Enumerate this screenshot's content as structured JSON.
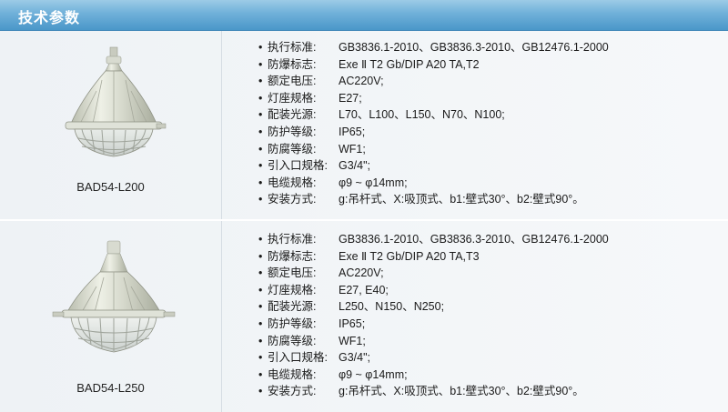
{
  "header": {
    "title": "技术参数"
  },
  "products": [
    {
      "model": "BAD54-L200",
      "specs": [
        {
          "label": "执行标准:",
          "value": "GB3836.1-2010、GB3836.3-2010、GB12476.1-2000"
        },
        {
          "label": "防爆标志:",
          "value": "Exe Ⅱ T2 Gb/DIP A20 TA,T2"
        },
        {
          "label": "额定电压:",
          "value": "AC220V;"
        },
        {
          "label": "灯座规格:",
          "value": "E27;"
        },
        {
          "label": "配装光源:",
          "value": "L70、L100、L150、N70、N100;"
        },
        {
          "label": "防护等级:",
          "value": "IP65;"
        },
        {
          "label": "防腐等级:",
          "value": "WF1;"
        },
        {
          "label": "引入口规格:",
          "value": "G3/4\";"
        },
        {
          "label": "电缆规格:",
          "value": "φ9 ~ φ14mm;"
        },
        {
          "label": "安装方式:",
          "value": "g:吊杆式、X:吸顶式、b1:壁式30°、b2:壁式90°。"
        }
      ]
    },
    {
      "model": "BAD54-L250",
      "specs": [
        {
          "label": "执行标准:",
          "value": "GB3836.1-2010、GB3836.3-2010、GB12476.1-2000"
        },
        {
          "label": "防爆标志:",
          "value": "Exe Ⅱ T2 Gb/DIP A20 TA,T3"
        },
        {
          "label": "额定电压:",
          "value": "AC220V;"
        },
        {
          "label": "灯座规格:",
          "value": "E27, E40;"
        },
        {
          "label": "配装光源:",
          "value": "L250、N150、N250;"
        },
        {
          "label": "防护等级:",
          "value": "IP65;"
        },
        {
          "label": "防腐等级:",
          "value": "WF1;"
        },
        {
          "label": "引入口规格:",
          "value": "G3/4\";"
        },
        {
          "label": "电缆规格:",
          "value": "φ9 ~ φ14mm;"
        },
        {
          "label": "安装方式:",
          "value": "g:吊杆式、X:吸顶式、b1:壁式30°、b2:壁式90°。"
        }
      ]
    }
  ]
}
